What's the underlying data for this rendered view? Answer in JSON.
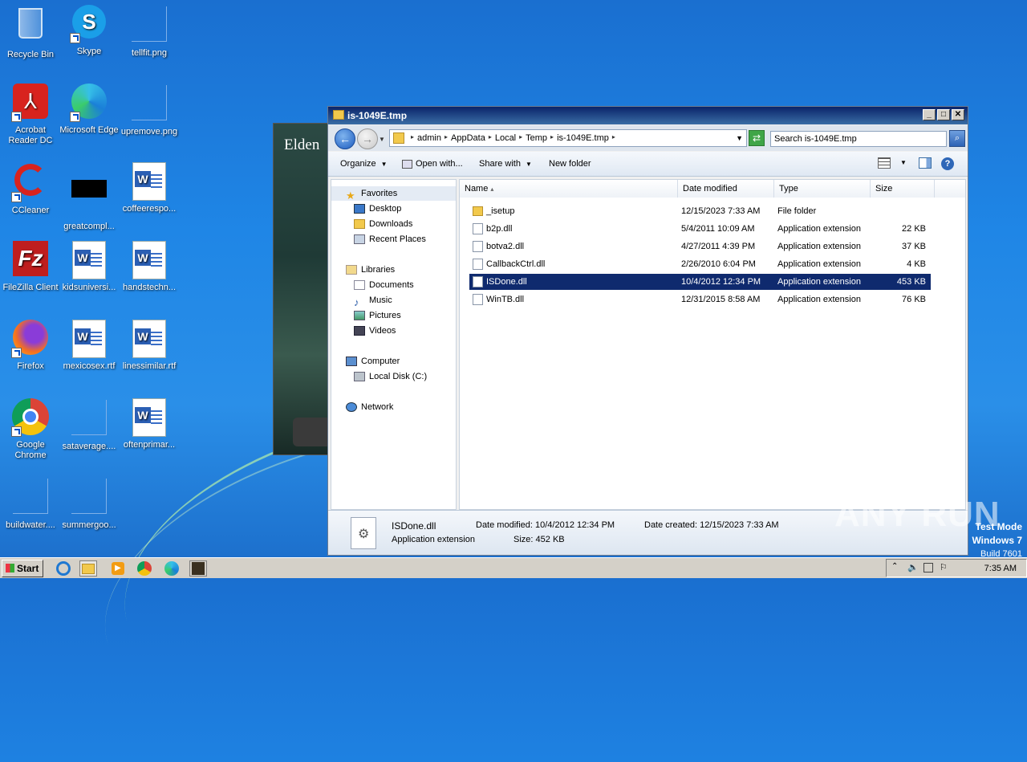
{
  "desktop": {
    "icons": [
      {
        "label": "Recycle Bin"
      },
      {
        "label": "Skype"
      },
      {
        "label": "tellfit.png"
      },
      {
        "label": "Acrobat Reader DC"
      },
      {
        "label": "Microsoft Edge"
      },
      {
        "label": "upremove.png"
      },
      {
        "label": "CCleaner"
      },
      {
        "label": "greatcompl..."
      },
      {
        "label": "coffeerespo..."
      },
      {
        "label": "FileZilla Client"
      },
      {
        "label": "kidsuniversi..."
      },
      {
        "label": "handstechn..."
      },
      {
        "label": "Firefox"
      },
      {
        "label": "mexicosex.rtf"
      },
      {
        "label": "linessimilar.rtf"
      },
      {
        "label": "Google Chrome"
      },
      {
        "label": "sataverage...."
      },
      {
        "label": "oftenprimar..."
      },
      {
        "label": "buildwater...."
      },
      {
        "label": "summergoo..."
      }
    ],
    "bg_app_title": "Elden"
  },
  "explorer": {
    "title": "is-1049E.tmp",
    "window_buttons": {
      "minimize": "_",
      "maximize": "□",
      "close": "✕"
    },
    "breadcrumb": [
      "admin",
      "AppData",
      "Local",
      "Temp",
      "is-1049E.tmp"
    ],
    "search_placeholder": "Search is-1049E.tmp",
    "toolbar": {
      "organize": "Organize",
      "open_with": "Open with...",
      "share_with": "Share with",
      "new_folder": "New folder"
    },
    "nav": {
      "favorites": "Favorites",
      "desktop": "Desktop",
      "downloads": "Downloads",
      "recent_places": "Recent Places",
      "libraries": "Libraries",
      "documents": "Documents",
      "music": "Music",
      "pictures": "Pictures",
      "videos": "Videos",
      "computer": "Computer",
      "local_disk": "Local Disk (C:)",
      "network": "Network"
    },
    "columns": {
      "name": "Name",
      "date": "Date modified",
      "type": "Type",
      "size": "Size"
    },
    "files": [
      {
        "name": "_isetup",
        "date": "12/15/2023 7:33 AM",
        "type": "File folder",
        "size": ""
      },
      {
        "name": "b2p.dll",
        "date": "5/4/2011 10:09 AM",
        "type": "Application extension",
        "size": "22 KB"
      },
      {
        "name": "botva2.dll",
        "date": "4/27/2011 4:39 PM",
        "type": "Application extension",
        "size": "37 KB"
      },
      {
        "name": "CallbackCtrl.dll",
        "date": "2/26/2010 6:04 PM",
        "type": "Application extension",
        "size": "4 KB"
      },
      {
        "name": "ISDone.dll",
        "date": "10/4/2012 12:34 PM",
        "type": "Application extension",
        "size": "453 KB"
      },
      {
        "name": "WinTB.dll",
        "date": "12/31/2015 8:58 AM",
        "type": "Application extension",
        "size": "76 KB"
      }
    ],
    "selected_index": 4,
    "details": {
      "name": "ISDone.dll",
      "type": "Application extension",
      "date_modified_label": "Date modified:",
      "date_modified": "10/4/2012 12:34 PM",
      "date_created_label": "Date created:",
      "date_created": "12/15/2023 7:33 AM",
      "size_label": "Size:",
      "size": "452 KB"
    }
  },
  "taskbar": {
    "start": "Start",
    "clock": "7:35 AM"
  },
  "overlay": {
    "watermark": "ANY RUN",
    "test_mode": "Test Mode",
    "os": "Windows 7",
    "build": "Build 7601"
  }
}
